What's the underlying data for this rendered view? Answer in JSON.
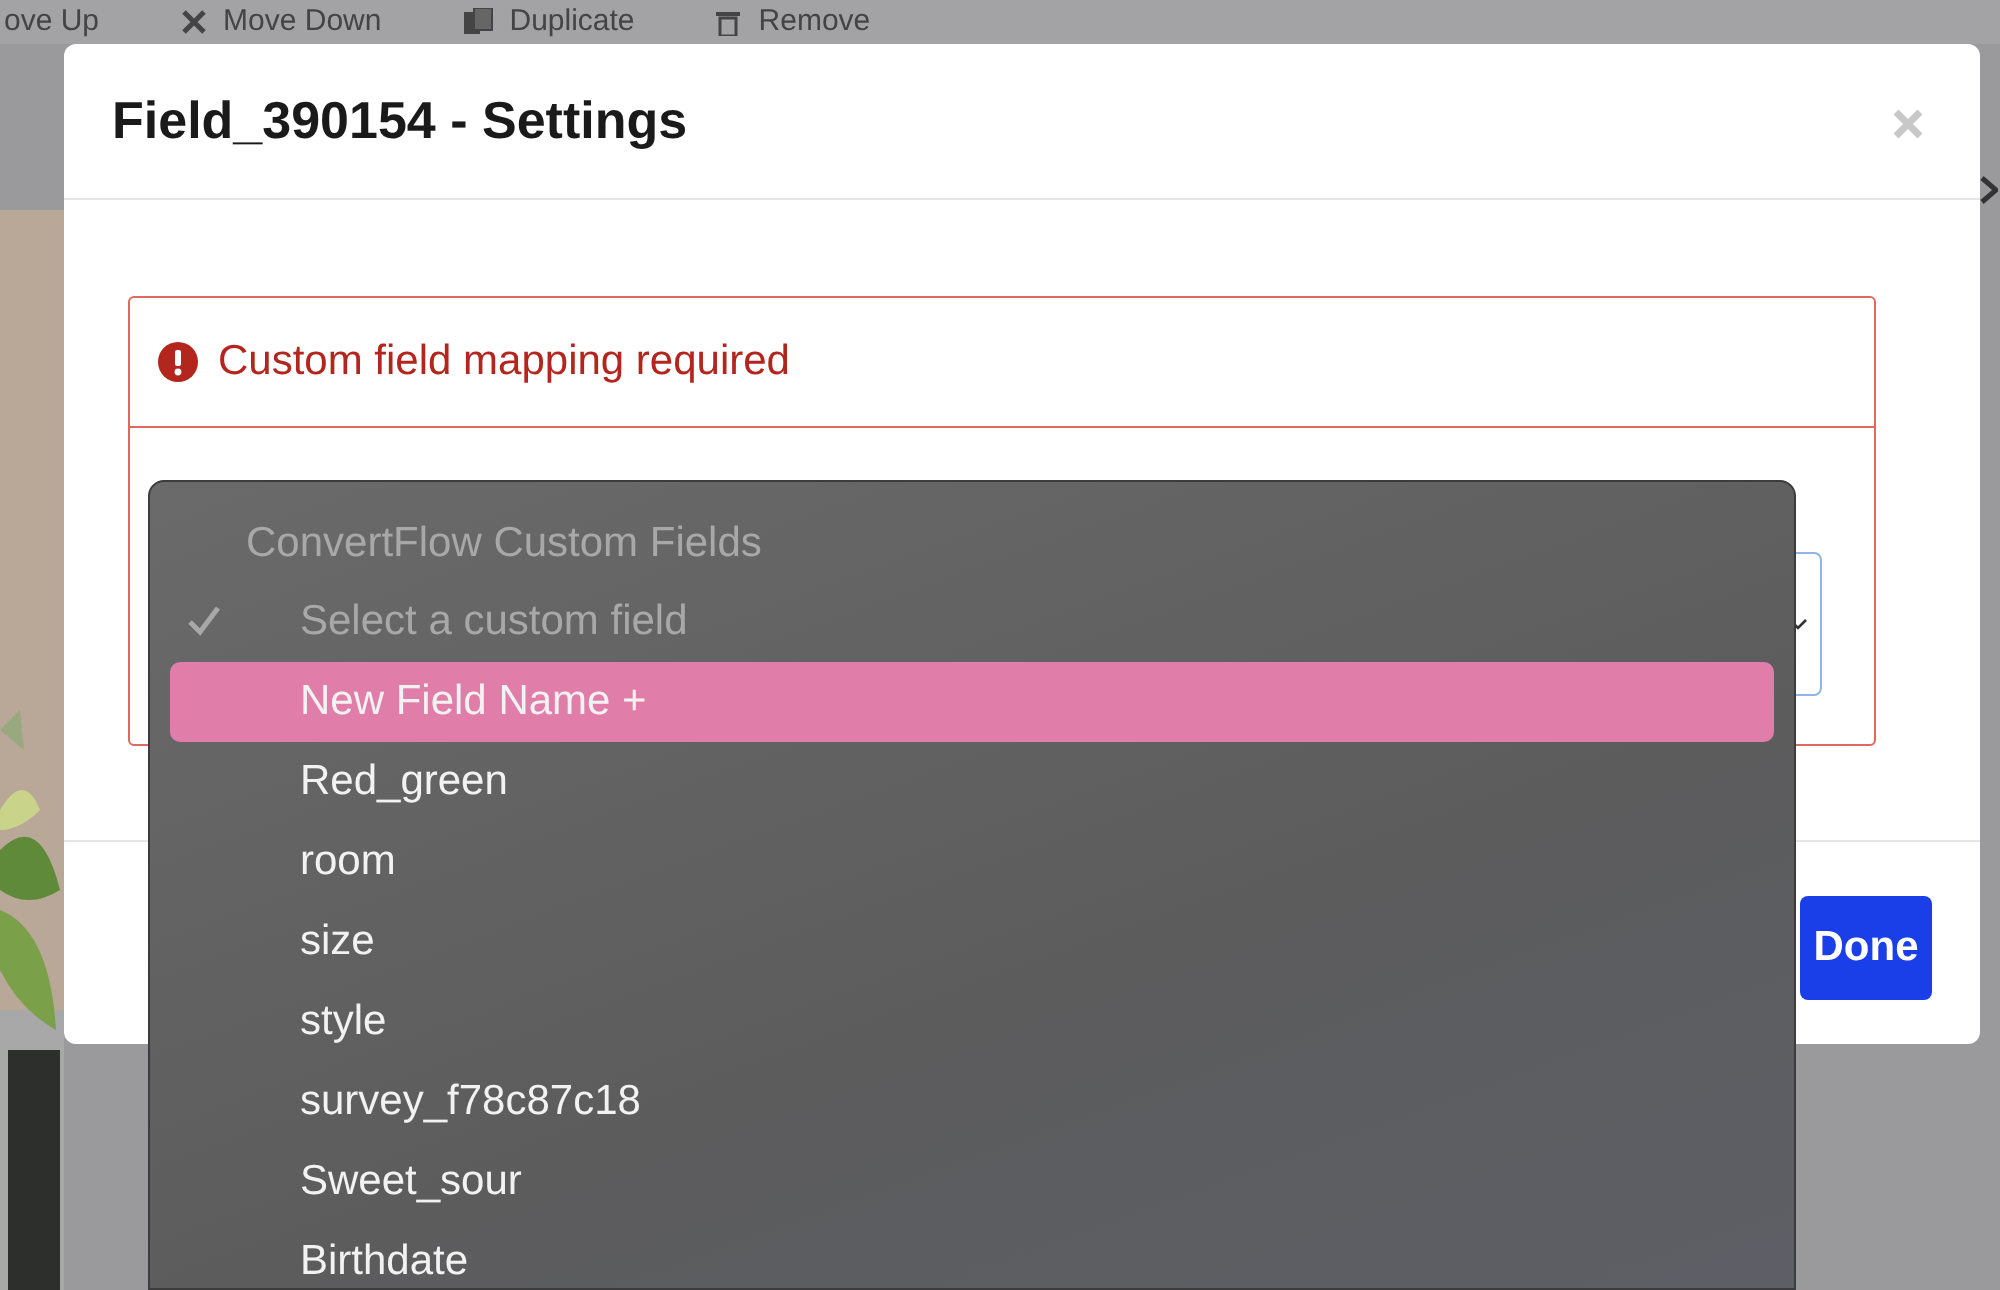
{
  "background_toolbar": {
    "items": [
      {
        "label": "ove Up"
      },
      {
        "label": "Move Down"
      },
      {
        "label": "Duplicate"
      },
      {
        "label": "Remove"
      }
    ]
  },
  "dialog": {
    "title": "Field_390154 - Settings",
    "alert": "Custom field mapping required",
    "done_button": "Done"
  },
  "dropdown": {
    "group": "ConvertFlow Custom Fields",
    "options": [
      {
        "label": "Select a custom field",
        "selected": true,
        "highlighted": false,
        "disabled": true
      },
      {
        "label": "New Field Name +",
        "selected": false,
        "highlighted": true,
        "disabled": false
      },
      {
        "label": "Red_green",
        "selected": false,
        "highlighted": false,
        "disabled": false
      },
      {
        "label": "room",
        "selected": false,
        "highlighted": false,
        "disabled": false
      },
      {
        "label": "size",
        "selected": false,
        "highlighted": false,
        "disabled": false
      },
      {
        "label": "style",
        "selected": false,
        "highlighted": false,
        "disabled": false
      },
      {
        "label": "survey_f78c87c18",
        "selected": false,
        "highlighted": false,
        "disabled": false
      },
      {
        "label": "Sweet_sour",
        "selected": false,
        "highlighted": false,
        "disabled": false
      },
      {
        "label": "Birthdate",
        "selected": false,
        "highlighted": false,
        "disabled": false
      }
    ]
  }
}
